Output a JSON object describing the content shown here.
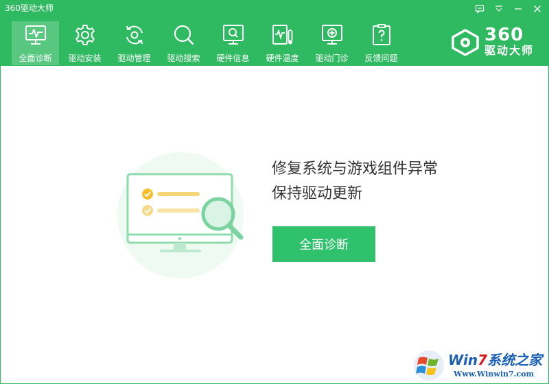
{
  "window": {
    "title": "360驱动大师"
  },
  "colors": {
    "primary": "#2fb961",
    "button": "#2fc16c",
    "text": "#333333"
  },
  "nav": {
    "items": [
      {
        "label": "全面诊断",
        "icon": "monitor-pulse-icon",
        "active": true
      },
      {
        "label": "驱动安装",
        "icon": "gear-icon"
      },
      {
        "label": "驱动管理",
        "icon": "refresh-gear-icon"
      },
      {
        "label": "驱动搜索",
        "icon": "search-icon"
      },
      {
        "label": "硬件信息",
        "icon": "monitor-search-icon"
      },
      {
        "label": "硬件温度",
        "icon": "thermometer-icon"
      },
      {
        "label": "驱动门诊",
        "icon": "medical-cross-icon"
      },
      {
        "label": "反馈问题",
        "icon": "question-clipboard-icon"
      }
    ]
  },
  "brand": {
    "number": "360",
    "name": "驱动大师"
  },
  "main": {
    "headline_line1": "修复系统与游戏组件异常",
    "headline_line2": "保持驱动更新",
    "diagnose_button": "全面诊断"
  },
  "watermark": {
    "title_prefix": "Win",
    "title_seven": "7",
    "title_suffix": "系统之家",
    "url": "Www.Winwin7.com"
  }
}
